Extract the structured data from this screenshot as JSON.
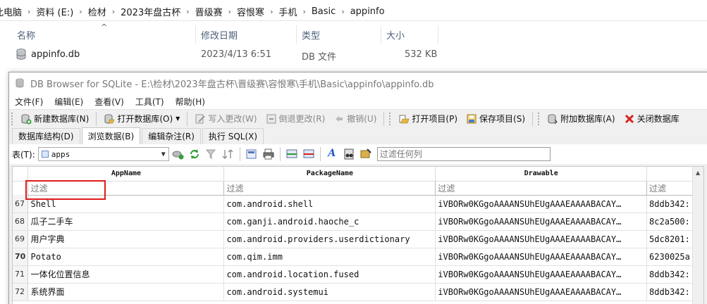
{
  "explorer": {
    "breadcrumbs": [
      "此电脑",
      "资料 (E:)",
      "检材",
      "2023年盘古杯",
      "晋级赛",
      "容恨寒",
      "手机",
      "Basic",
      "appinfo"
    ],
    "columns": {
      "name": "名称",
      "date": "修改日期",
      "type": "类型",
      "size": "大小"
    },
    "file": {
      "name": "appinfo.db",
      "date": "2023/4/13 6:51",
      "type": "DB 文件",
      "size": "532 KB",
      "icon": "database-icon"
    }
  },
  "app": {
    "title": "DB Browser for SQLite - E:\\检材\\2023年盘古杯\\晋级赛\\容恨寒\\手机\\Basic\\appinfo\\appinfo.db",
    "menu": [
      "文件(F)",
      "编辑(E)",
      "查看(V)",
      "工具(T)",
      "帮助(H)"
    ],
    "toolbar": {
      "new_db": "新建数据库(N)",
      "open_db": "打开数据库(O)",
      "write_changes": "写入更改(W)",
      "revert_changes": "倒退更改(R)",
      "undo": "撤销(U)",
      "open_project": "打开项目(P)",
      "save_project": "保存项目(S)",
      "attach_db": "附加数据库(A)",
      "close_db": "关闭数据库"
    },
    "tabs": [
      "数据库结构(D)",
      "浏览数据(B)",
      "编辑杂注(R)",
      "执行 SQL(X)"
    ],
    "active_tab": 1,
    "browse": {
      "table_label": "表(T):",
      "table_value": "apps",
      "filter_all_placeholder": "过滤任何列"
    },
    "grid": {
      "columns": [
        "AppName",
        "PackageName",
        "Drawable",
        ""
      ],
      "filter_placeholder": "过滤",
      "rows": [
        {
          "num": "67",
          "app": "Shell",
          "pkg": "com.android.shell",
          "draw": "iVBORw0KGgoAAAANSUhEUgAAAEAAAABACAY…",
          "extra": "8ddb342:"
        },
        {
          "num": "68",
          "app": "瓜子二手车",
          "pkg": "com.ganji.android.haoche_c",
          "draw": "iVBORw0KGgoAAAANSUhEUgAAAEAAAABACAY…",
          "extra": "8c2a500:"
        },
        {
          "num": "69",
          "app": "用户字典",
          "pkg": "com.android.providers.userdictionary",
          "draw": "iVBORw0KGgoAAAANSUhEUgAAAEAAAABACAY…",
          "extra": "5dc8201:"
        },
        {
          "num": "70",
          "app": "Potato",
          "pkg": "com.qim.imm",
          "draw": "iVBORw0KGgoAAAANSUhEUgAAAEAAAABACAY…",
          "extra": "6230025a"
        },
        {
          "num": "71",
          "app": "一体化位置信息",
          "pkg": "com.android.location.fused",
          "draw": "iVBORw0KGgoAAAANSUhEUgAAAEAAAABACAY…",
          "extra": "8ddb342:"
        },
        {
          "num": "72",
          "app": "系统界面",
          "pkg": "com.android.systemui",
          "draw": "iVBORw0KGgoAAAANSUhEUgAAAEAAAABACAY…",
          "extra": "8ddb342:"
        }
      ]
    }
  }
}
